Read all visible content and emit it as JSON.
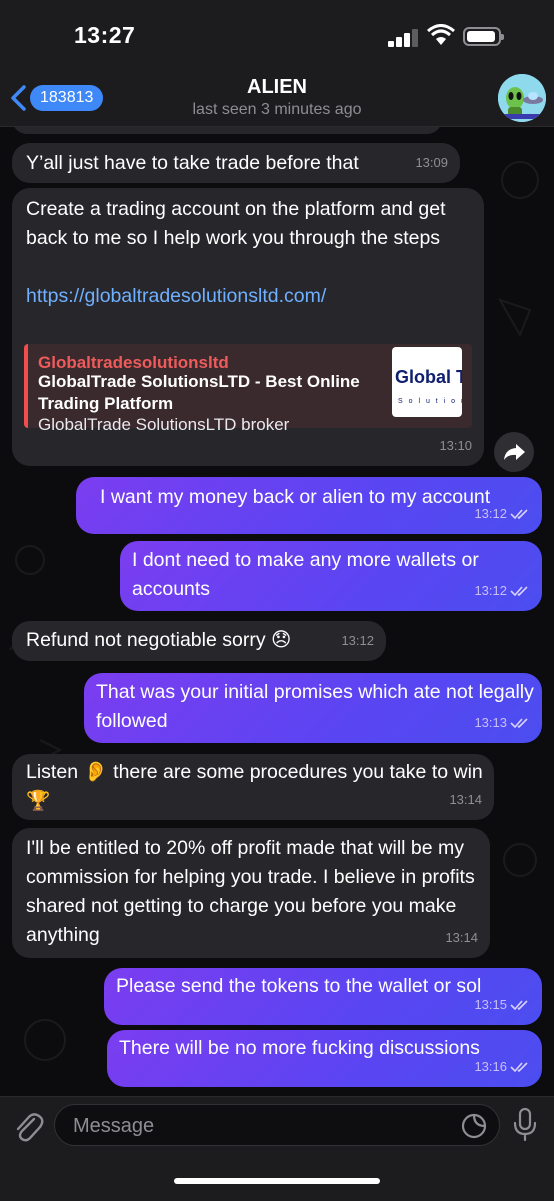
{
  "status_bar": {
    "time": "13:27"
  },
  "header": {
    "back_count": "183813",
    "title": "ALIEN",
    "subtitle": "last seen 3 minutes ago"
  },
  "messages": [
    {
      "dir": "in",
      "text": "Y’all just have to take trade before that",
      "time": "13:09"
    },
    {
      "dir": "in",
      "text": "Create a trading account on the platform and get back to me so I help work you through the steps",
      "link": "https://globaltradesolutionsltd.com/",
      "time": "13:10",
      "preview": {
        "site": "Globaltradesolutionsltd",
        "title": "GlobalTrade SolutionsLTD - Best Online Trading Platform",
        "description": "GlobalTrade SolutionsLTD broker",
        "image_text": "Global Tra",
        "image_subtext": "S o l u t i o n s"
      }
    },
    {
      "dir": "out",
      "text": "I want my money back or alien to my account",
      "time": "13:12"
    },
    {
      "dir": "out",
      "text": "I dont need to make any more wallets or accounts",
      "time": "13:12"
    },
    {
      "dir": "in",
      "text": "Refund not negotiable sorry 😞",
      "time": "13:12"
    },
    {
      "dir": "out",
      "text": "That was your initial promises which ate not legally followed",
      "time": "13:13"
    },
    {
      "dir": "in",
      "text": "Listen 👂 there are some procedures you take to win 🏆",
      "time": "13:14"
    },
    {
      "dir": "in",
      "text": "I'll be entitled to 20% off profit made that will be my commission for helping you trade. I believe in profits shared not getting to charge you before you make anything",
      "time": "13:14"
    },
    {
      "dir": "out",
      "text": "Please send the tokens to the wallet or sol",
      "time": "13:15"
    },
    {
      "dir": "out",
      "text": "There will be no more fucking discussions",
      "time": "13:16"
    }
  ],
  "input": {
    "placeholder": "Message"
  },
  "colors": {
    "outgoing": "#6a42f1",
    "incoming": "#27262b",
    "link": "#6fb0ff",
    "accent": "#3e88f7"
  }
}
